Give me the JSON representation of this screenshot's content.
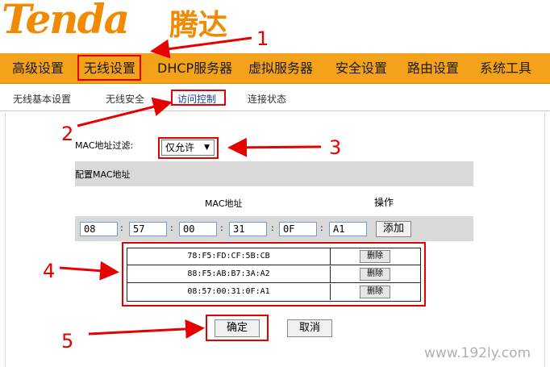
{
  "header": {
    "logo_text": "Tenda",
    "logo_cn": "腾达",
    "brand_color": "#f08a00"
  },
  "main_nav": {
    "items": [
      {
        "label": "高级设置"
      },
      {
        "label": "无线设置"
      },
      {
        "label": "DHCP服务器"
      },
      {
        "label": "虚拟服务器"
      },
      {
        "label": "安全设置"
      },
      {
        "label": "路由设置"
      },
      {
        "label": "系统工具"
      }
    ],
    "active": "无线设置",
    "bg_color": "#f4a21a"
  },
  "sub_nav": {
    "items": [
      {
        "label": "无线基本设置"
      },
      {
        "label": "无线安全"
      },
      {
        "label": "访问控制"
      },
      {
        "label": "连接状态"
      }
    ],
    "active": "访问控制"
  },
  "mac_filter": {
    "label": "MAC地址过滤:",
    "selected": "仅允许",
    "dropdown_icon": "triangle-down-icon"
  },
  "config": {
    "title": "配置MAC地址",
    "col_mac": "MAC地址",
    "col_op": "操作",
    "inputs": [
      "08",
      "57",
      "00",
      "31",
      "0F",
      "A1"
    ],
    "separator": ":",
    "add_label": "添加"
  },
  "mac_list": {
    "rows": [
      {
        "mac": "78:F5:FD:CF:5B:CB",
        "action": "删除"
      },
      {
        "mac": "88:F5:AB:B7:3A:A2",
        "action": "删除"
      },
      {
        "mac": "08:57:00:31:0F:A1",
        "action": "删除"
      }
    ]
  },
  "footer": {
    "confirm_label": "确定",
    "cancel_label": "取消"
  },
  "annotations": {
    "numbers": [
      "1",
      "2",
      "3",
      "4",
      "5"
    ],
    "color": "#e60000"
  },
  "watermark": "www.192ly.com"
}
